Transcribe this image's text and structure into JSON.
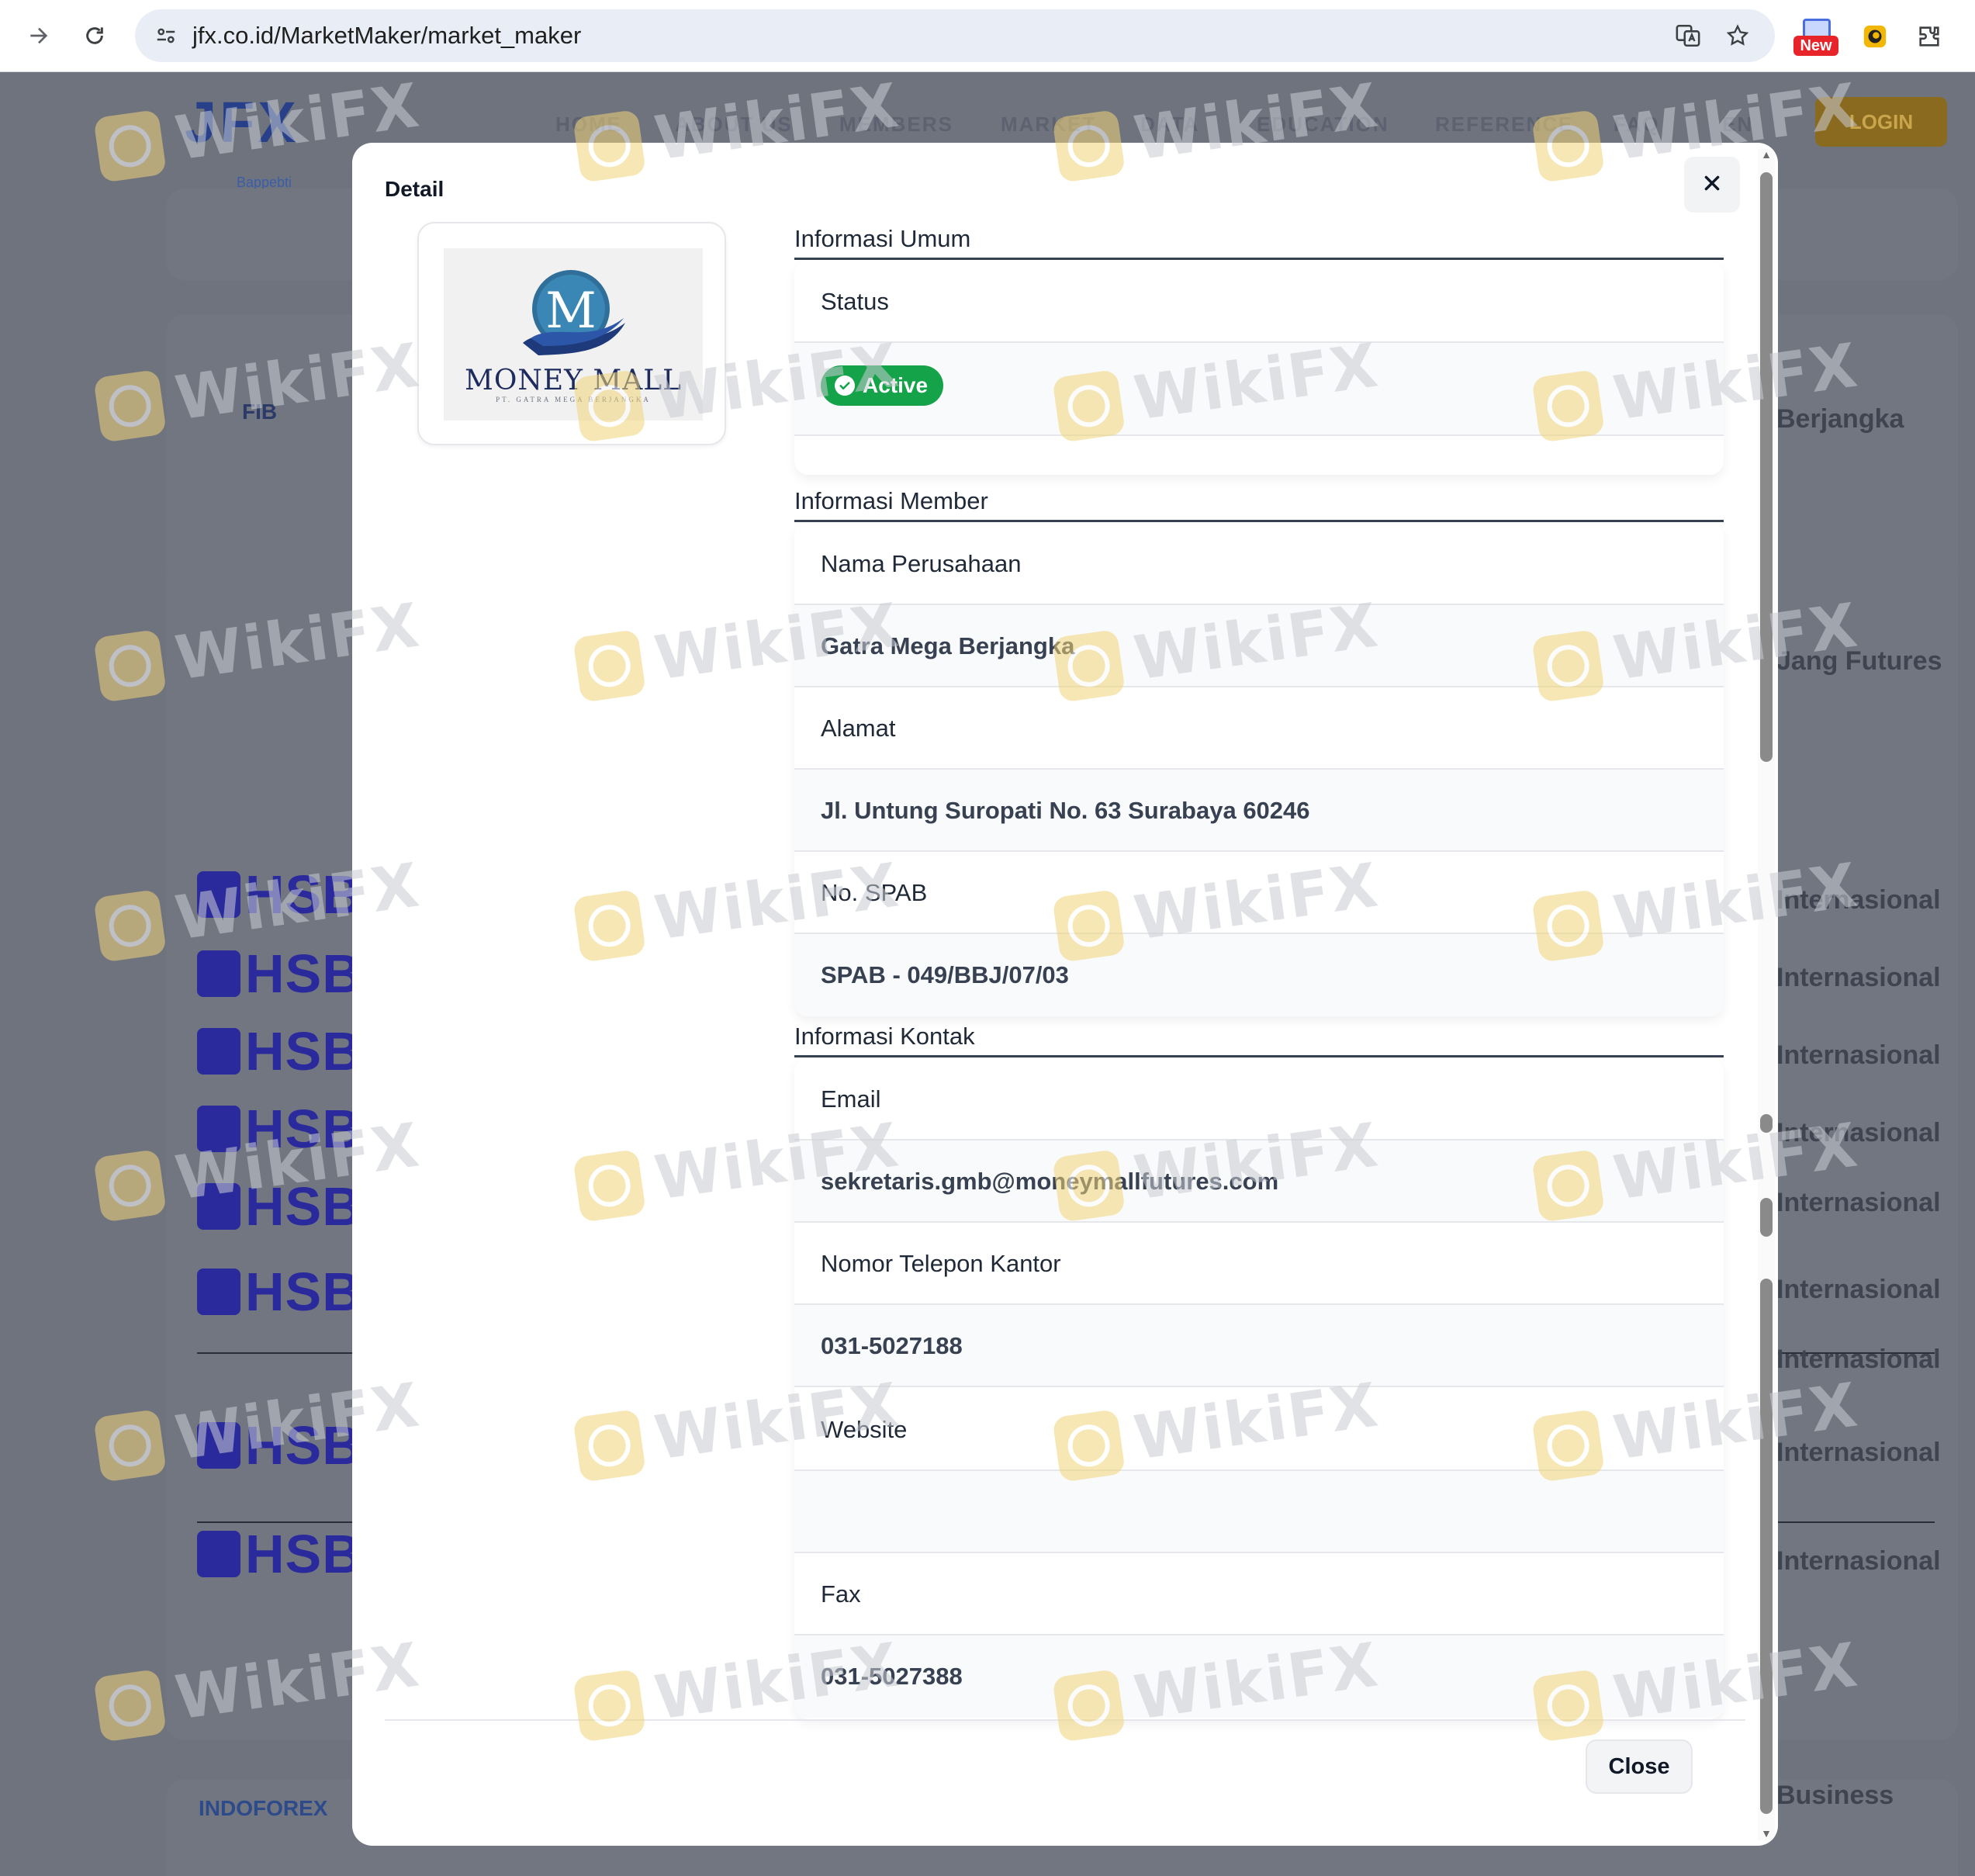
{
  "browser": {
    "url": "jfx.co.id/MarketMaker/market_maker",
    "new_badge": "New"
  },
  "background": {
    "logo": "JFX",
    "logo_sub": "Bappebti",
    "menu": [
      "HOME",
      "ABOUT US",
      "MEMBERS",
      "MARKET",
      "DATA",
      "EDUCATION",
      "REFERENCE",
      "FAQ",
      "EN"
    ],
    "login": "LOGIN",
    "brand_fib": "FIB",
    "brand_indoforex": "INDOFOREX",
    "hsb_label": "HSB",
    "right_labels": [
      "Berjangka",
      "Jang Futures",
      "Internasional",
      "Internasional",
      "Internasional",
      "Internasional",
      "Internasional",
      "Internasional",
      "Internasional",
      "Internasional",
      "Internasional",
      "Business"
    ]
  },
  "modal": {
    "title": "Detail",
    "logo": {
      "letter": "M",
      "name": "MONEY MALL",
      "tagline": "PT. GATRA MEGA BERJANGKA"
    },
    "sections": {
      "umum": {
        "title": "Informasi Umum",
        "status_label": "Status",
        "status_value": "Active"
      },
      "member": {
        "title": "Informasi Member",
        "rows": [
          {
            "label": "Nama Perusahaan",
            "value": "Gatra Mega Berjangka"
          },
          {
            "label": "Alamat",
            "value": "Jl. Untung Suropati No. 63 Surabaya 60246"
          },
          {
            "label": "No. SPAB",
            "value": "SPAB - 049/BBJ/07/03"
          }
        ]
      },
      "kontak": {
        "title": "Informasi Kontak",
        "rows": [
          {
            "label": "Email",
            "value": "sekretaris.gmb@moneymallfutures.com"
          },
          {
            "label": "Nomor Telepon Kantor",
            "value": "031-5027188"
          },
          {
            "label": "Website",
            "value": ""
          },
          {
            "label": "Fax",
            "value": "031-5027388"
          }
        ]
      }
    },
    "close_label": "Close"
  },
  "watermark": "WikiFX",
  "colors": {
    "status_active": "#15a34a",
    "overlay": "#6f737e",
    "hsb_blue": "#2a2a9c"
  }
}
